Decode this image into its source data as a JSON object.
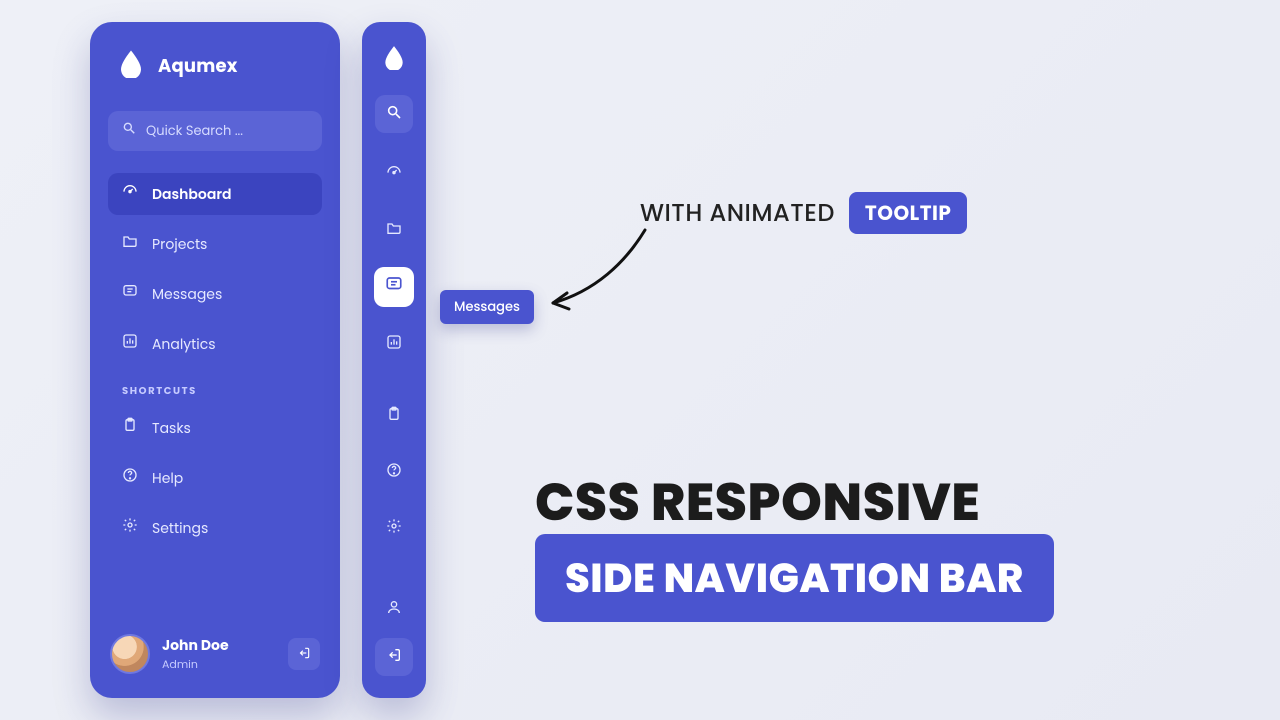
{
  "brand": {
    "name": "Aqumex"
  },
  "search": {
    "placeholder": "Quick Search ..."
  },
  "nav": {
    "items": [
      {
        "label": "Dashboard",
        "icon": "gauge",
        "active": true
      },
      {
        "label": "Projects",
        "icon": "folder",
        "active": false
      },
      {
        "label": "Messages",
        "icon": "chat",
        "active": false
      },
      {
        "label": "Analytics",
        "icon": "chart",
        "active": false
      }
    ],
    "section_label": "SHORTCUTS",
    "shortcuts": [
      {
        "label": "Tasks",
        "icon": "clipboard"
      },
      {
        "label": "Help",
        "icon": "help"
      },
      {
        "label": "Settings",
        "icon": "gear"
      }
    ]
  },
  "user": {
    "name": "John Doe",
    "role": "Admin"
  },
  "collapsed": {
    "tooltip": "Messages",
    "hover_index": 2
  },
  "hero": {
    "top_text": "WITH ANIMATED",
    "badge": "TOOLTIP",
    "line1": "CSS RESPONSIVE",
    "line2": "SIDE NAVIGATION BAR"
  },
  "colors": {
    "primary": "#4a54cf",
    "primary_light": "#5b64d6",
    "primary_dark": "#3b44bf"
  }
}
